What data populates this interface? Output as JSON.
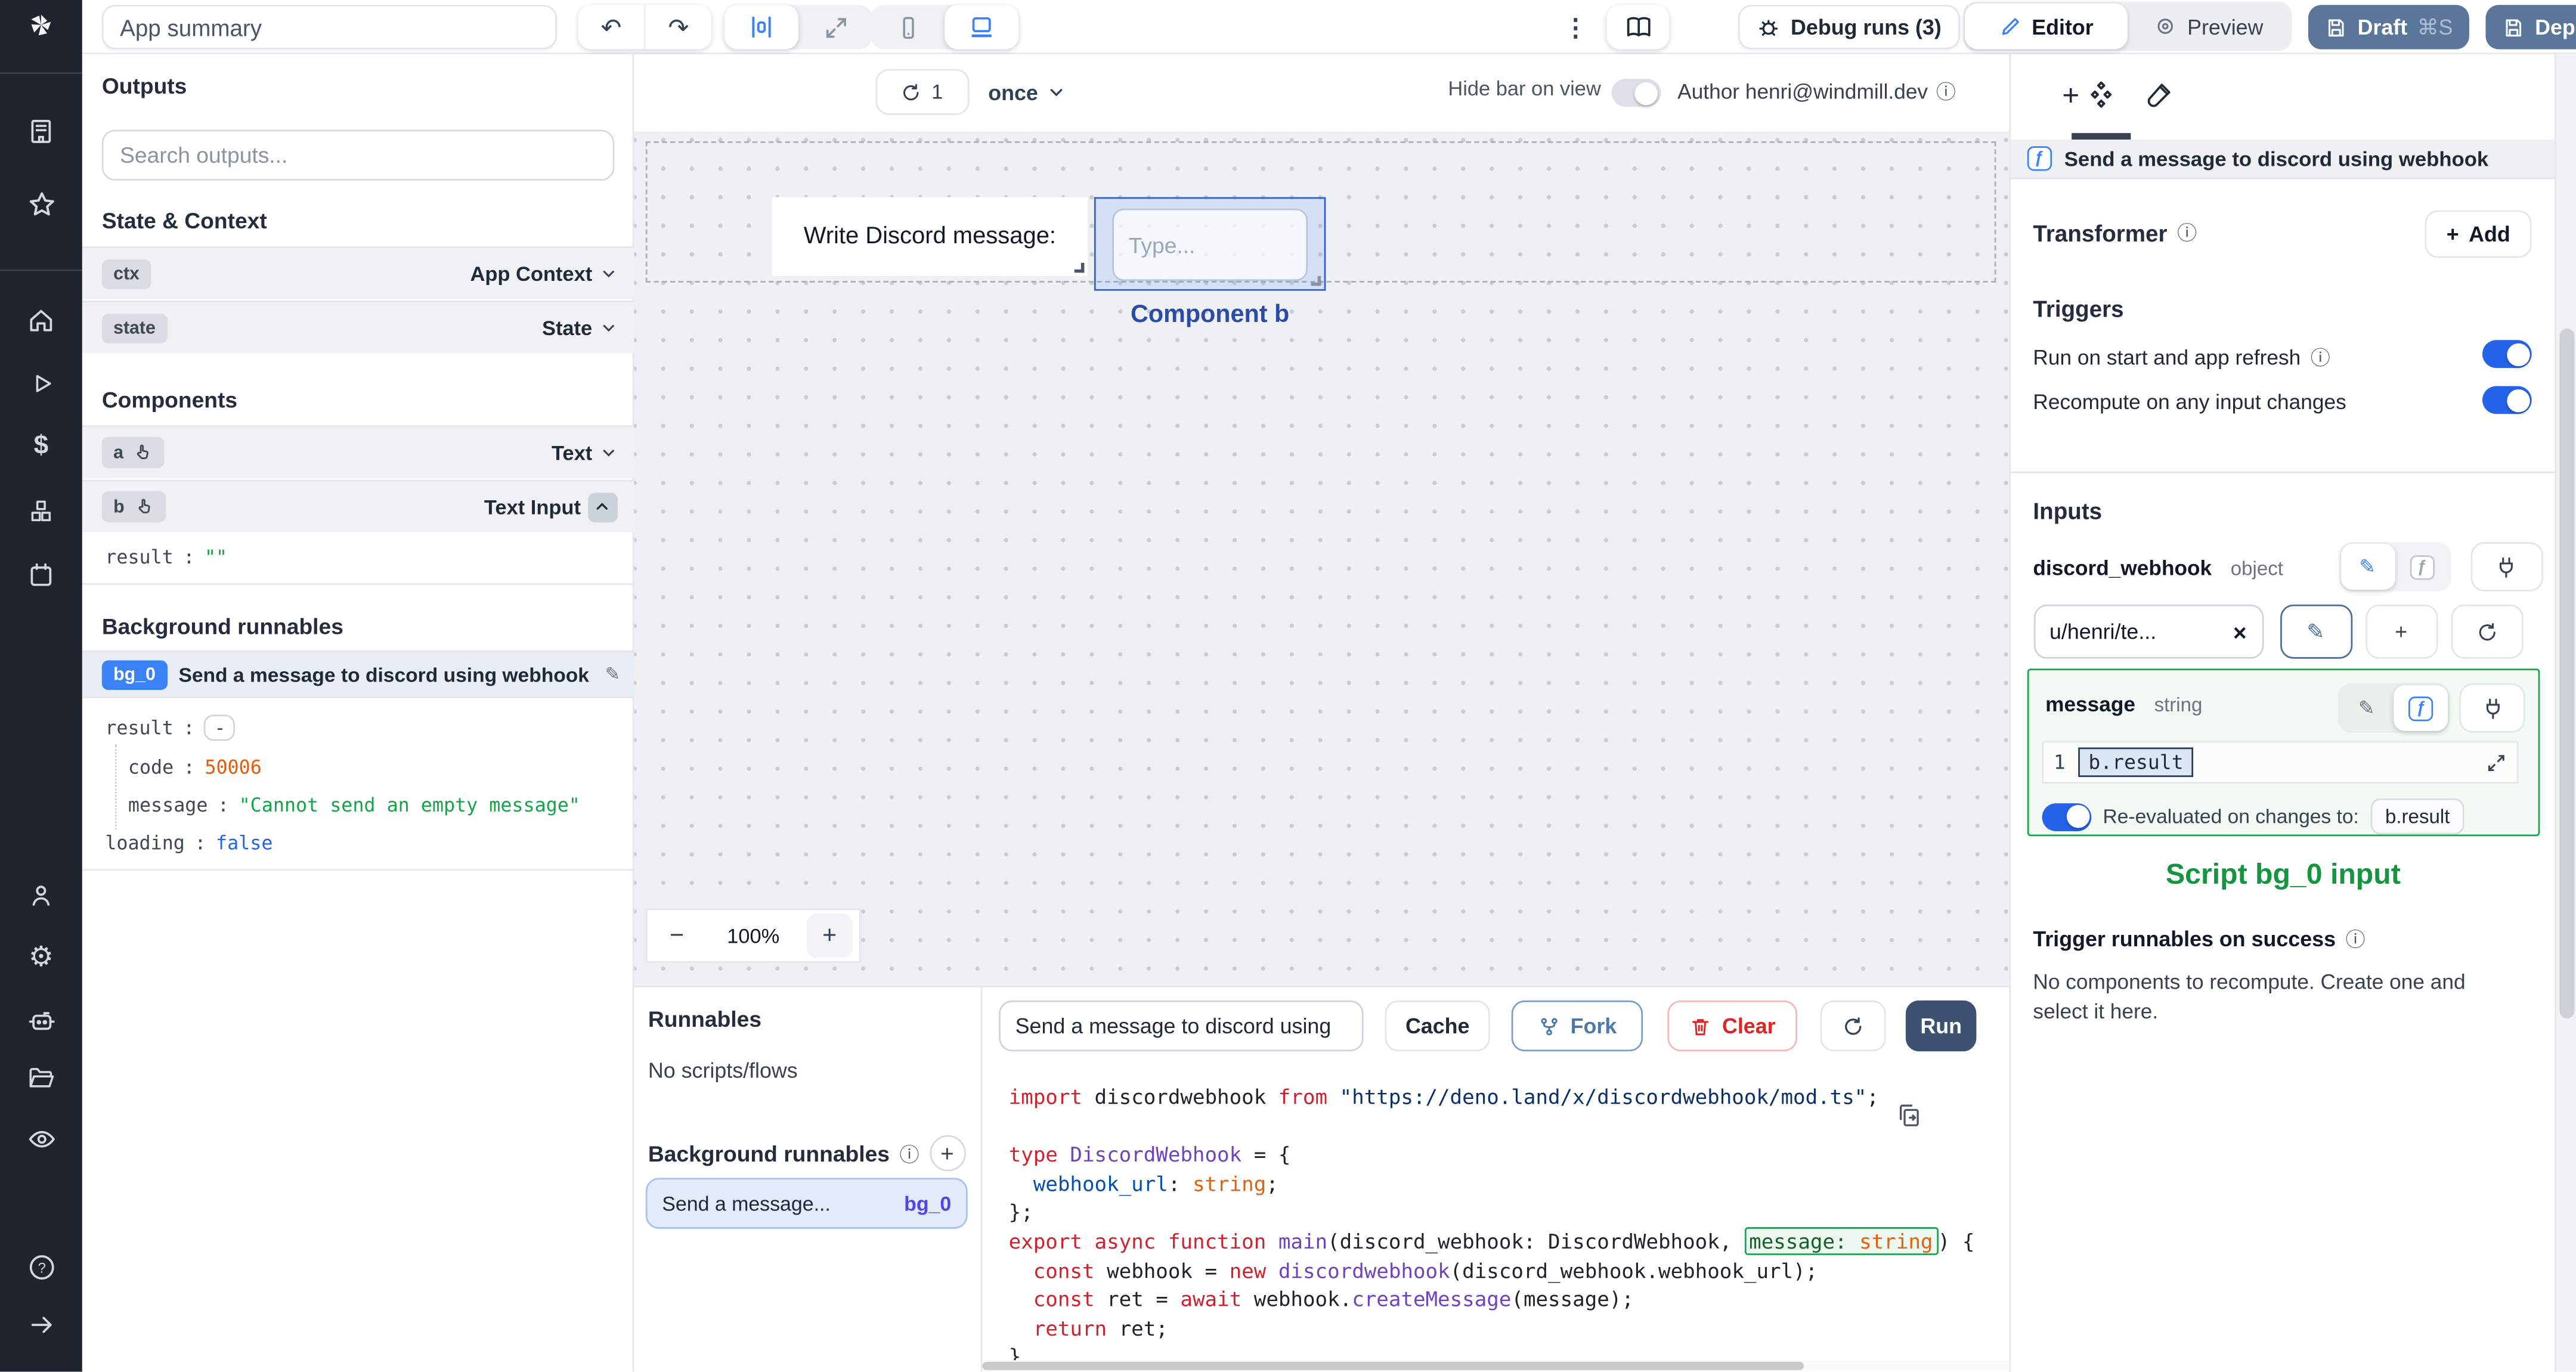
{
  "topbar": {
    "app_summary": "App summary",
    "debug_runs": "Debug runs (3)",
    "editor": "Editor",
    "preview": "Preview",
    "draft": "Draft",
    "draft_shortcut": "⌘S",
    "deploy": "Deploy"
  },
  "outputs": {
    "title": "Outputs",
    "search_placeholder": "Search outputs...",
    "state_context_title": "State & Context",
    "ctx_key": "ctx",
    "ctx_type": "App Context",
    "state_key": "state",
    "state_type": "State",
    "components_title": "Components",
    "a_key": "a",
    "a_type": "Text",
    "b_key": "b",
    "b_type": "Text Input",
    "b_result_key": "result",
    "b_result_value": "\"\"",
    "background_title": "Background runnables",
    "bg_badge": "bg_0",
    "bg_name": "Send a message to discord using webhook",
    "result_key": "result",
    "result_value": "-",
    "code_key": "code",
    "code_value": "50006",
    "message_key": "message",
    "message_value": "\"Cannot send an empty message\"",
    "loading_key": "loading",
    "loading_value": "false"
  },
  "canvas": {
    "refresh_count": "1",
    "schedule": "once",
    "hide_bar_label": "Hide bar on view",
    "author": "Author henri@windmill.dev",
    "text_component": "Write Discord message:",
    "input_placeholder": "Type...",
    "selected_label": "Component b",
    "zoom_out": "−",
    "zoom_value": "100%",
    "zoom_in": "+"
  },
  "runnables": {
    "title": "Runnables",
    "empty": "No scripts/flows",
    "background_title": "Background runnables",
    "item_name": "Send a message...",
    "item_badge": "bg_0"
  },
  "editor": {
    "name_value": "Send a message to discord using",
    "cache": "Cache",
    "fork": "Fork",
    "clear": "Clear",
    "run": "Run",
    "code_lines": [
      [
        {
          "t": "import",
          "c": "kw"
        },
        {
          "t": " discordwebhook ",
          "c": "pl"
        },
        {
          "t": "from",
          "c": "kw"
        },
        {
          "t": " \"https://deno.land/x/discordwebhook/mod.ts\"",
          "c": "str"
        },
        {
          "t": ";",
          "c": "pl"
        }
      ],
      [],
      [
        {
          "t": "type",
          "c": "kw"
        },
        {
          "t": " DiscordWebhook",
          "c": "typ"
        },
        {
          "t": " = {",
          "c": "pl"
        }
      ],
      [
        {
          "t": "  ",
          "c": "pl"
        },
        {
          "t": "webhook_url",
          "c": "prop"
        },
        {
          "t": ": ",
          "c": "pl"
        },
        {
          "t": "string",
          "c": "org"
        },
        {
          "t": ";",
          "c": "pl"
        }
      ],
      [
        {
          "t": "};",
          "c": "pl"
        }
      ],
      [
        {
          "t": "export",
          "c": "kw"
        },
        {
          "t": " async",
          "c": "kw"
        },
        {
          "t": " function",
          "c": "kw"
        },
        {
          "t": " main",
          "c": "typ"
        },
        {
          "t": "(discord_webhook: DiscordWebhook, ",
          "c": "pl"
        },
        {
          "t": "message:",
          "c": "grn",
          "hl": true
        },
        {
          "t": " string",
          "c": "org",
          "hl": true
        },
        {
          "t": ") {",
          "c": "pl"
        }
      ],
      [
        {
          "t": "  ",
          "c": "pl"
        },
        {
          "t": "const",
          "c": "kw"
        },
        {
          "t": " webhook = ",
          "c": "pl"
        },
        {
          "t": "new",
          "c": "kw"
        },
        {
          "t": " discordwebhook",
          "c": "typ"
        },
        {
          "t": "(discord_webhook.webhook_url);",
          "c": "pl"
        }
      ],
      [
        {
          "t": "  ",
          "c": "pl"
        },
        {
          "t": "const",
          "c": "kw"
        },
        {
          "t": " ret = ",
          "c": "pl"
        },
        {
          "t": "await",
          "c": "kw"
        },
        {
          "t": " webhook.",
          "c": "pl"
        },
        {
          "t": "createMessage",
          "c": "typ"
        },
        {
          "t": "(message);",
          "c": "pl"
        }
      ],
      [
        {
          "t": "  ",
          "c": "pl"
        },
        {
          "t": "return",
          "c": "kw"
        },
        {
          "t": " ret;",
          "c": "pl"
        }
      ],
      [
        {
          "t": "}",
          "c": "pl"
        }
      ]
    ]
  },
  "right": {
    "header": "Send a message to discord using webhook",
    "f_glyph": "ƒ",
    "transformer": "Transformer",
    "add": "Add",
    "triggers": "Triggers",
    "trigger1": "Run on start and app refresh",
    "trigger2": "Recompute on any input changes",
    "inputs": "Inputs",
    "dw_name": "discord_webhook",
    "dw_type": "object",
    "dw_value": "u/henri/te...",
    "msg_name": "message",
    "msg_type": "string",
    "line_no": "1",
    "expr": "b.result",
    "reeval_label": "Re-evaluated on changes to:",
    "reeval_badge": "b.result",
    "script_label": "Script bg_0 input",
    "trigger_success": "Trigger runnables on success",
    "empty_note": "No components to recompute. Create one and select it here."
  },
  "colors": {
    "accent": "#3b82f6",
    "toggle_on": "#2563eb",
    "draft_bg": "#5b769b",
    "run_bg": "#3d5170",
    "green": "#16a34a",
    "orange": "#e8590b",
    "value_blue": "#2563eb",
    "indigo": "#4f46e5",
    "component_label": "#2a4ba6",
    "rail_bg": "#1f242e"
  }
}
